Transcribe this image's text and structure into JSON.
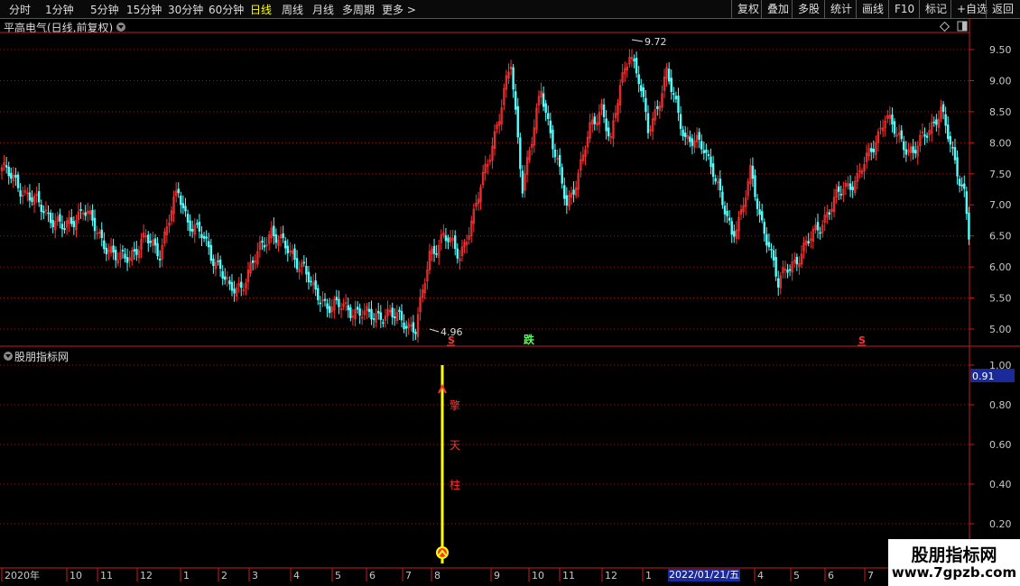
{
  "toolbar": {
    "periods": [
      "分时",
      "1分钟",
      "5分钟",
      "15分钟",
      "30分钟",
      "60分钟",
      "日线",
      "周线",
      "月线",
      "多周期",
      "更多 >"
    ],
    "active_period": "日线",
    "right_buttons": [
      "复权",
      "叠加",
      "多股",
      "统计",
      "画线",
      "F10",
      "标记",
      "+自选",
      "返回"
    ]
  },
  "stock": {
    "title": "平高电气(日线,前复权)"
  },
  "indicator": {
    "title": "股朋指标网",
    "current_value": "0.91",
    "signal_text": [
      "擎",
      "天",
      "柱"
    ]
  },
  "price_axis": [
    "9.50",
    "9.00",
    "8.50",
    "8.00",
    "7.50",
    "7.00",
    "6.50",
    "6.00",
    "5.50",
    "5.00"
  ],
  "indicator_axis": [
    "1.00",
    "0.80",
    "0.60",
    "0.40",
    "0.20"
  ],
  "annotations": {
    "high": "9.72",
    "low": "4.96",
    "mark_s": "S",
    "mark_die": "跌"
  },
  "time_axis": [
    {
      "label": "2020年"
    },
    {
      "label": "10"
    },
    {
      "label": "11"
    },
    {
      "label": "12"
    },
    {
      "label": "1"
    },
    {
      "label": "2"
    },
    {
      "label": "3"
    },
    {
      "label": "4"
    },
    {
      "label": "5"
    },
    {
      "label": "6"
    },
    {
      "label": "7"
    },
    {
      "label": "8"
    },
    {
      "label": "9"
    },
    {
      "label": "10"
    },
    {
      "label": "11"
    },
    {
      "label": "12"
    },
    {
      "label": "1"
    },
    {
      "label": "4"
    },
    {
      "label": "5"
    },
    {
      "label": "6"
    },
    {
      "label": "7"
    }
  ],
  "highlight_date": "2022/01/21/五",
  "watermark": {
    "title": "股朋指标网",
    "url": "www.7gpzb.com"
  },
  "colors": {
    "up": "#ff3333",
    "down": "#54ffff",
    "grid": "#8a1414",
    "axis": "#c81e1e",
    "signal": "#ffff00"
  },
  "chart_data": {
    "type": "candlestick",
    "ylim": [
      4.8,
      9.8
    ],
    "anchors": [
      [
        0,
        7.6
      ],
      [
        10,
        7.2
      ],
      [
        20,
        6.85
      ],
      [
        27,
        6.6
      ],
      [
        35,
        6.95
      ],
      [
        42,
        6.5
      ],
      [
        50,
        6.1
      ],
      [
        55,
        6.2
      ],
      [
        62,
        6.45
      ],
      [
        68,
        6.25
      ],
      [
        73,
        6.9
      ],
      [
        76,
        7.2
      ],
      [
        80,
        6.75
      ],
      [
        86,
        6.5
      ],
      [
        90,
        6.2
      ],
      [
        94,
        6.0
      ],
      [
        98,
        5.6
      ],
      [
        103,
        5.7
      ],
      [
        110,
        6.2
      ],
      [
        116,
        6.6
      ],
      [
        122,
        6.3
      ],
      [
        130,
        6.0
      ],
      [
        134,
        5.6
      ],
      [
        140,
        5.4
      ],
      [
        146,
        5.35
      ],
      [
        152,
        5.3
      ],
      [
        158,
        5.2
      ],
      [
        165,
        5.25
      ],
      [
        172,
        5.15
      ],
      [
        178,
        5.0
      ],
      [
        181,
        5.55
      ],
      [
        184,
        6.2
      ],
      [
        190,
        6.5
      ],
      [
        197,
        6.2
      ],
      [
        203,
        6.8
      ],
      [
        208,
        7.6
      ],
      [
        214,
        8.4
      ],
      [
        219,
        9.3
      ],
      [
        224,
        7.3
      ],
      [
        228,
        8.0
      ],
      [
        232,
        8.9
      ],
      [
        238,
        7.8
      ],
      [
        243,
        7.0
      ],
      [
        248,
        7.5
      ],
      [
        253,
        8.2
      ],
      [
        258,
        8.6
      ],
      [
        262,
        8.0
      ],
      [
        266,
        8.9
      ],
      [
        270,
        9.5
      ],
      [
        274,
        9.0
      ],
      [
        278,
        8.2
      ],
      [
        282,
        8.6
      ],
      [
        286,
        9.1
      ],
      [
        290,
        8.6
      ],
      [
        294,
        8.1
      ],
      [
        298,
        8.0
      ],
      [
        302,
        7.9
      ],
      [
        306,
        7.6
      ],
      [
        310,
        7.0
      ],
      [
        314,
        6.5
      ],
      [
        318,
        6.9
      ],
      [
        322,
        7.5
      ],
      [
        326,
        6.8
      ],
      [
        330,
        6.4
      ],
      [
        334,
        5.7
      ],
      [
        338,
        6.0
      ],
      [
        344,
        6.2
      ],
      [
        350,
        6.6
      ],
      [
        356,
        6.9
      ],
      [
        362,
        7.3
      ],
      [
        368,
        7.4
      ],
      [
        374,
        7.9
      ],
      [
        380,
        8.4
      ],
      [
        386,
        8.1
      ],
      [
        392,
        7.8
      ],
      [
        398,
        8.2
      ],
      [
        404,
        8.5
      ],
      [
        410,
        7.7
      ],
      [
        414,
        7.2
      ],
      [
        416,
        6.5
      ]
    ],
    "signal_day": 181,
    "indicator_value": 0.91
  }
}
